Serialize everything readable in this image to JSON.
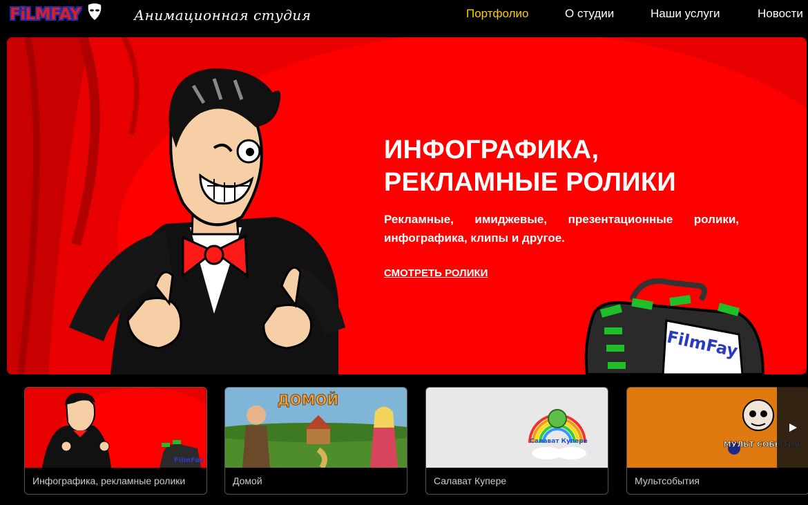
{
  "header": {
    "logo_text": "FiLMFAY",
    "tagline": "Анимационная студия",
    "nav": [
      {
        "label": "Портфолио",
        "active": true
      },
      {
        "label": "О студии",
        "active": false
      },
      {
        "label": "Наши услуги",
        "active": false
      },
      {
        "label": "Новости",
        "active": false
      }
    ]
  },
  "hero": {
    "title_line1": "ИНФОГРАФИКА,",
    "title_line2": "РЕКЛАМНЫЕ РОЛИКИ",
    "description": "Рекламные, имиджевые, презентационные ролики, инфографика, клипы и другое.",
    "link_label": "СМОТРЕТЬ РОЛИКИ",
    "briefcase_text": "FilmFay"
  },
  "cards": [
    {
      "caption": "Инфографика, рекламные ролики",
      "thumb_text": "FilmFay"
    },
    {
      "caption": "Домой",
      "thumb_text": "ДОМОЙ"
    },
    {
      "caption": "Салават Купере",
      "thumb_text": "Салават Купере"
    },
    {
      "caption": "Мультсобытия",
      "thumb_text": "МУЛЬТ СОБЫТИЯ"
    }
  ],
  "carousel": {
    "next_icon": "play-right-arrow"
  },
  "colors": {
    "accent": "#ffcb05",
    "hero_red": "#e60000",
    "logo_red": "#d81f26",
    "logo_blue": "#1d2fa8"
  }
}
